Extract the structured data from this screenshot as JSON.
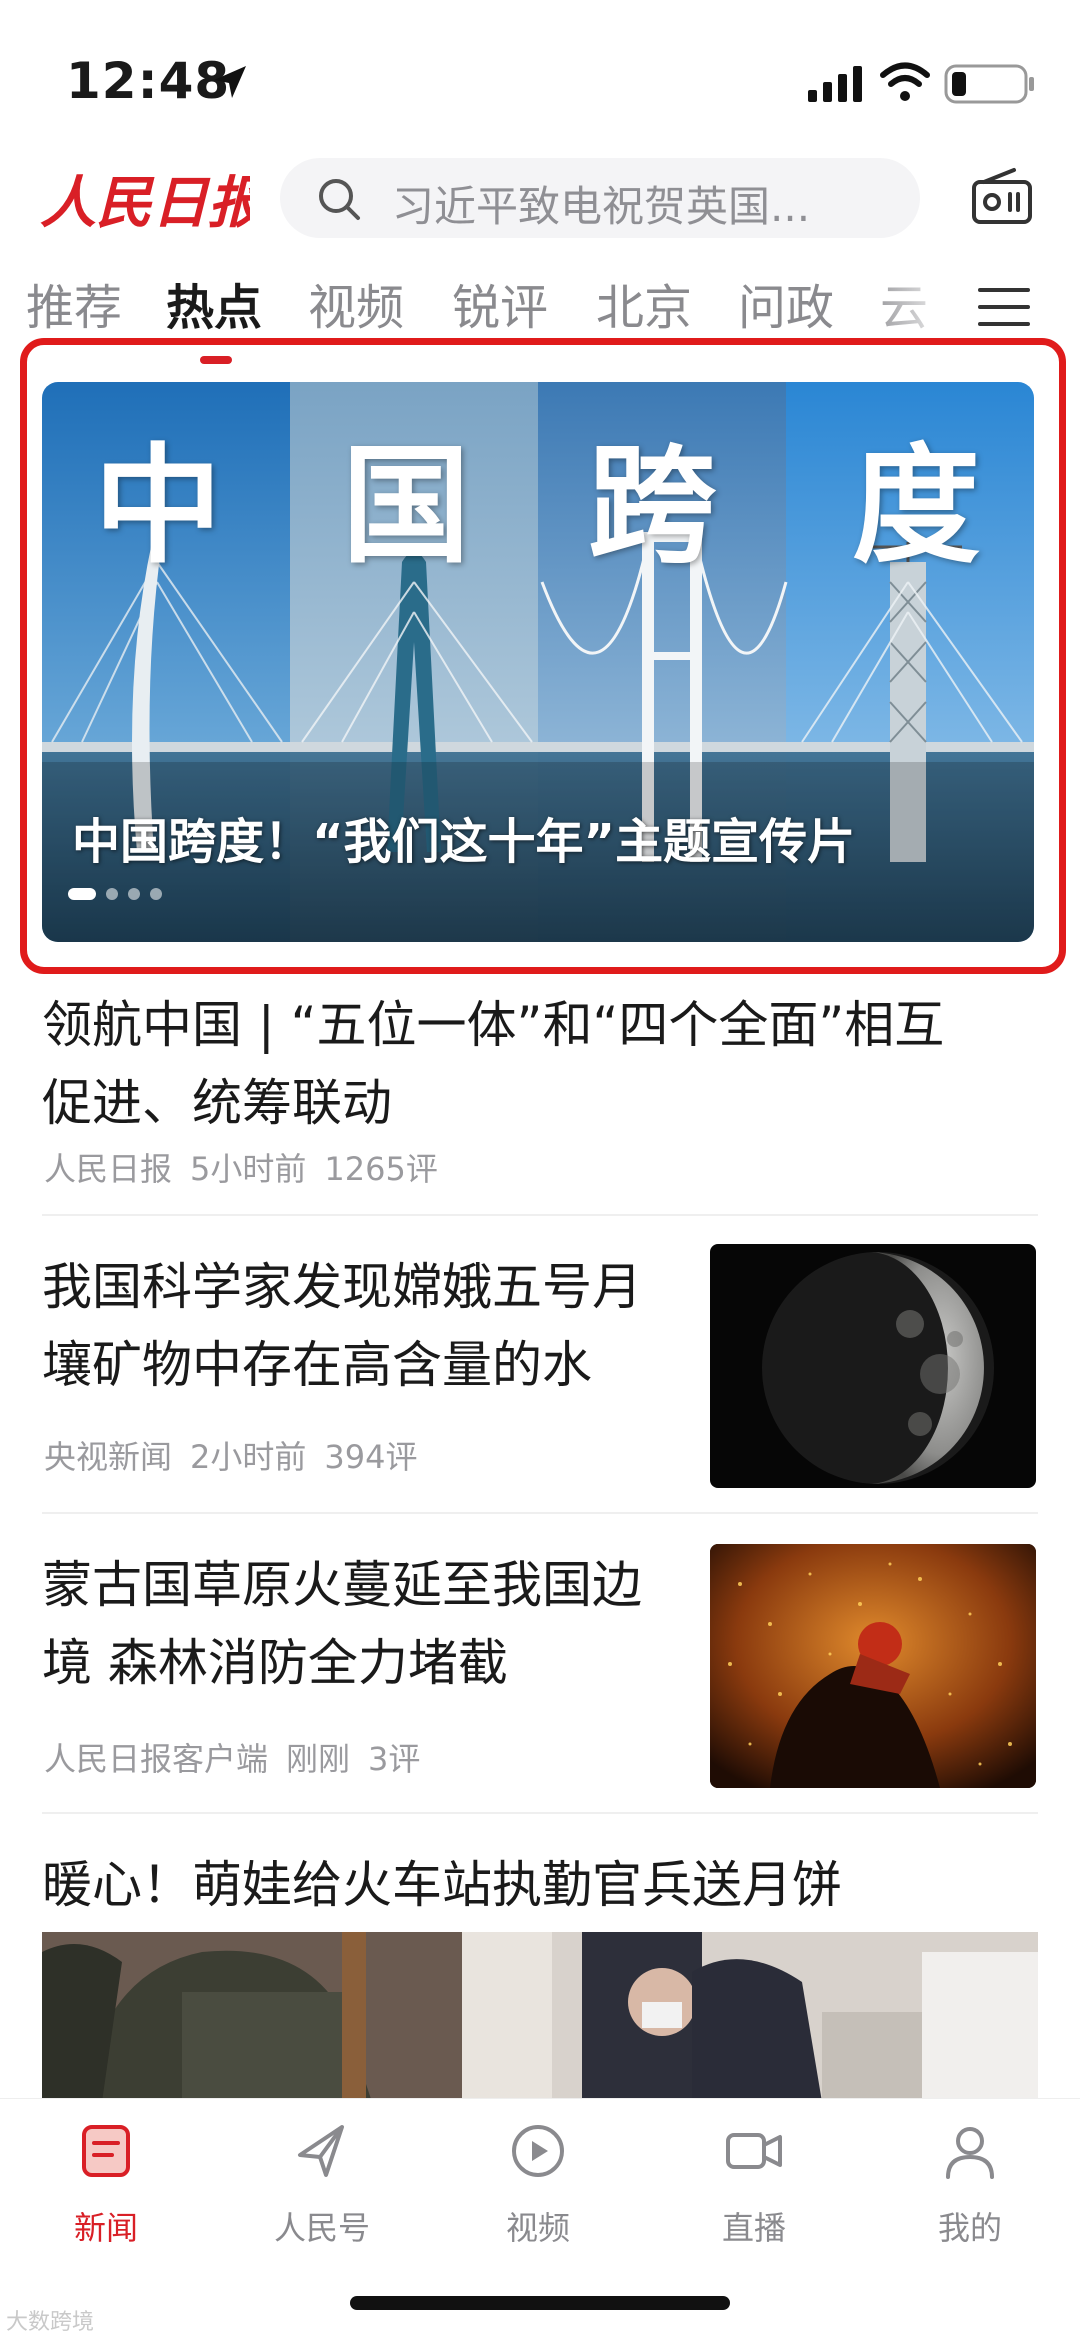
{
  "status_bar": {
    "time": "12:48"
  },
  "header": {
    "logo_text": "人民日报",
    "search_placeholder": "习近平致电祝贺英国..."
  },
  "tabs": [
    {
      "label": "推荐",
      "active": false
    },
    {
      "label": "热点",
      "active": true
    },
    {
      "label": "视频",
      "active": false
    },
    {
      "label": "锐评",
      "active": false
    },
    {
      "label": "北京",
      "active": false
    },
    {
      "label": "问政",
      "active": false
    },
    {
      "label": "云",
      "active": false
    }
  ],
  "banner": {
    "title_chars": [
      "中",
      "国",
      "跨",
      "度"
    ],
    "caption": "中国跨度！“我们这十年”主题宣传片",
    "slide_count": 4,
    "current_slide": 1
  },
  "articles": [
    {
      "title_lines": [
        "领航中国 | “五位一体”和“四个全面”相互",
        "促进、统筹联动"
      ],
      "source": "人民日报",
      "time": "5小时前",
      "comments": "1265评",
      "thumb": null
    },
    {
      "title_lines": [
        "我国科学家发现嫦娥五号月",
        "壤矿物中存在高含量的水"
      ],
      "source": "央视新闻",
      "time": "2小时前",
      "comments": "394评",
      "thumb": "moon-image"
    },
    {
      "title_lines": [
        "蒙古国草原火蔓延至我国边",
        "境 森林消防全力堵截"
      ],
      "source": "人民日报客户端",
      "time": "刚刚",
      "comments": "3评",
      "thumb": "firefighter-image"
    },
    {
      "title_lines": [
        "暖心！萌娃给火车站执勤官兵送月饼"
      ],
      "thumb": "video-strip-image"
    }
  ],
  "bottom_nav": [
    {
      "label": "新闻",
      "icon": "news-icon",
      "active": true
    },
    {
      "label": "人民号",
      "icon": "paper-plane-icon",
      "active": false
    },
    {
      "label": "视频",
      "icon": "play-icon",
      "active": false
    },
    {
      "label": "直播",
      "icon": "camera-icon",
      "active": false
    },
    {
      "label": "我的",
      "icon": "user-icon",
      "active": false
    }
  ],
  "watermark": "大数跨境",
  "colors": {
    "brand_red": "#d91f26",
    "outline_red": "#e01b1b",
    "meta_gray": "#9a9a9e"
  }
}
